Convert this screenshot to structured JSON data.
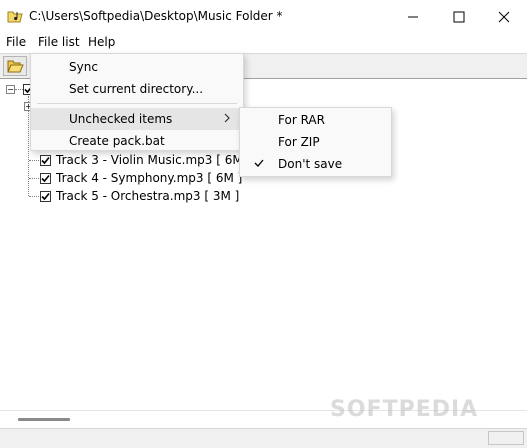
{
  "window": {
    "title": "C:\\Users\\Softpedia\\Desktop\\Music Folder *",
    "app_icon": "music-folder-icon",
    "controls": [
      "minimize-icon",
      "maximize-icon",
      "close-icon"
    ]
  },
  "menubar": {
    "file": "File",
    "file_list": "File list",
    "help": "Help"
  },
  "toolbar": {
    "open_icon": "open-folder-icon"
  },
  "file_list_menu": {
    "items": [
      {
        "label": "Sync"
      },
      {
        "label": "Set current directory..."
      },
      {
        "label": "Unchecked items",
        "submenu": true
      },
      {
        "label": "Create pack.bat"
      }
    ]
  },
  "unchecked_submenu": {
    "items": [
      {
        "label": "For RAR",
        "checked": false
      },
      {
        "label": "For ZIP",
        "checked": false
      },
      {
        "label": "Don't save",
        "checked": true
      }
    ]
  },
  "tree": {
    "tracks": [
      {
        "label": "Track 3 - Violin Music.mp3 [ 6M ]",
        "checked": true
      },
      {
        "label": "Track 4 - Symphony.mp3 [ 6M ]",
        "checked": true
      },
      {
        "label": "Track 5 - Orchestra.mp3 [ 3M ]",
        "checked": true
      }
    ]
  },
  "watermark": "SOFTPEDIA"
}
